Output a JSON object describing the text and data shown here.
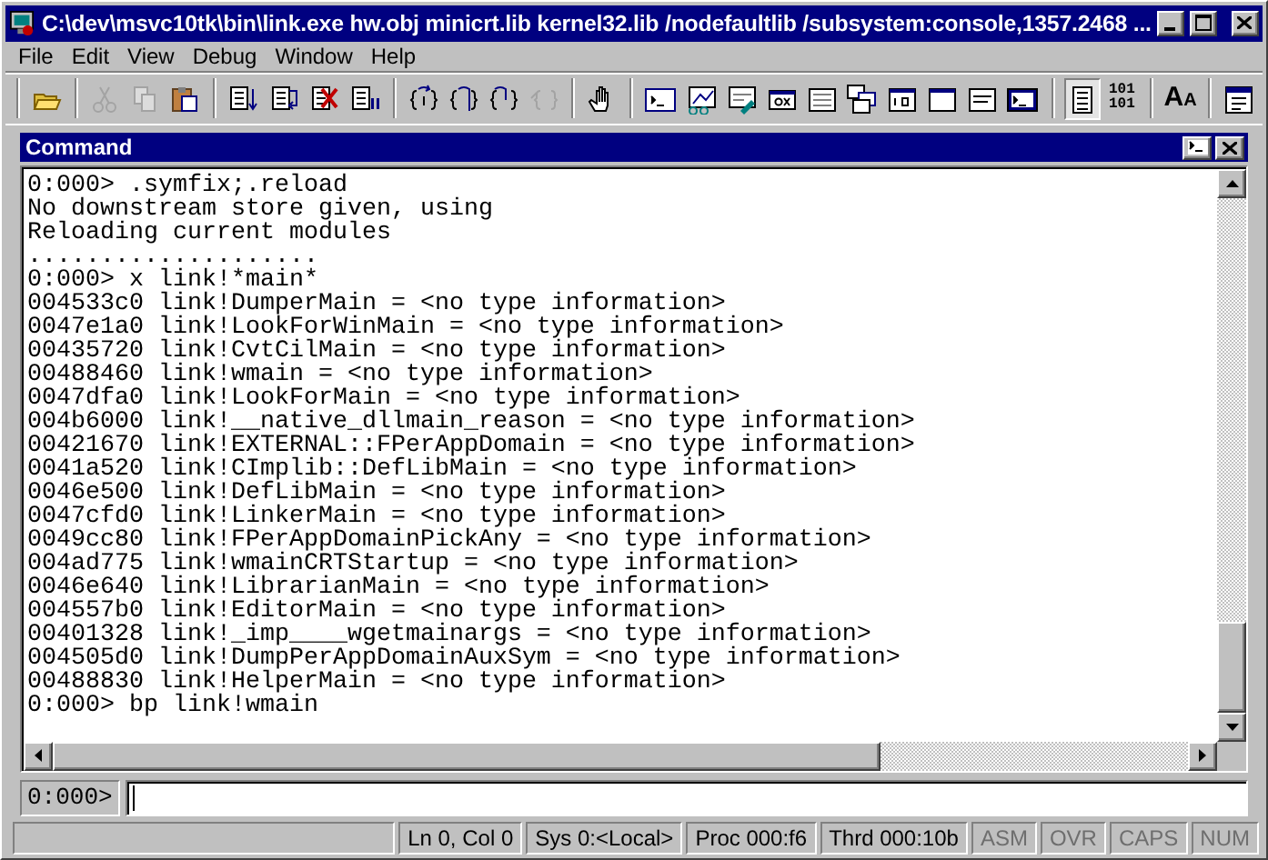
{
  "window": {
    "title": "C:\\dev\\msvc10tk\\bin\\link.exe hw.obj minicrt.lib kernel32.lib /nodefaultlib /subsystem:console,1357.2468 ..."
  },
  "menu": [
    "File",
    "Edit",
    "View",
    "Debug",
    "Window",
    "Help"
  ],
  "toolbar": [
    {
      "kind": "separator"
    },
    {
      "kind": "icon",
      "disabled": false,
      "pressed": false
    },
    {
      "kind": "separator"
    },
    {
      "kind": "icon",
      "disabled": true,
      "pressed": false
    },
    {
      "kind": "icon",
      "disabled": true,
      "pressed": false
    },
    {
      "kind": "icon",
      "disabled": false,
      "pressed": false
    },
    {
      "kind": "separator"
    },
    {
      "kind": "icon",
      "disabled": false,
      "pressed": false
    },
    {
      "kind": "icon",
      "disabled": false,
      "pressed": false
    },
    {
      "kind": "icon",
      "disabled": false,
      "pressed": false
    },
    {
      "kind": "icon",
      "disabled": false,
      "pressed": false
    },
    {
      "kind": "separator"
    },
    {
      "kind": "icon",
      "disabled": false,
      "pressed": false
    },
    {
      "kind": "icon",
      "disabled": false,
      "pressed": false
    },
    {
      "kind": "icon",
      "disabled": false,
      "pressed": false
    },
    {
      "kind": "icon",
      "disabled": true,
      "pressed": false
    },
    {
      "kind": "separator"
    },
    {
      "kind": "icon",
      "disabled": false,
      "pressed": false
    },
    {
      "kind": "separator"
    },
    {
      "kind": "icon",
      "disabled": false,
      "pressed": false
    },
    {
      "kind": "icon",
      "disabled": false,
      "pressed": false
    },
    {
      "kind": "icon",
      "disabled": false,
      "pressed": false
    },
    {
      "kind": "icon",
      "disabled": false,
      "pressed": false
    },
    {
      "kind": "icon",
      "disabled": false,
      "pressed": false
    },
    {
      "kind": "icon",
      "disabled": false,
      "pressed": false
    },
    {
      "kind": "icon",
      "disabled": false,
      "pressed": false
    },
    {
      "kind": "icon",
      "disabled": false,
      "pressed": false
    },
    {
      "kind": "icon",
      "disabled": false,
      "pressed": false
    },
    {
      "kind": "icon",
      "disabled": false,
      "pressed": false
    },
    {
      "kind": "separator"
    },
    {
      "kind": "icon",
      "disabled": false,
      "pressed": true
    },
    {
      "kind": "text",
      "lines": [
        "101",
        "101"
      ],
      "disabled": false,
      "pressed": false
    },
    {
      "kind": "separator"
    },
    {
      "kind": "text",
      "lines": [
        "A$_{A}$"
      ],
      "disabled": false,
      "pressed": false
    },
    {
      "kind": "separator"
    },
    {
      "kind": "icon",
      "disabled": false,
      "pressed": false
    }
  ],
  "command_window": {
    "title": "Command",
    "output": [
      "0:000> .symfix;.reload",
      "No downstream store given, using",
      "Reloading current modules",
      "....................",
      "0:000> x link!*main*",
      "004533c0 link!DumperMain = <no type information>",
      "0047e1a0 link!LookForWinMain = <no type information>",
      "00435720 link!CvtCilMain = <no type information>",
      "00488460 link!wmain = <no type information>",
      "0047dfa0 link!LookForMain = <no type information>",
      "004b6000 link!__native_dllmain_reason = <no type information>",
      "00421670 link!EXTERNAL::FPerAppDomain = <no type information>",
      "0041a520 link!CImplib::DefLibMain = <no type information>",
      "0046e500 link!DefLibMain = <no type information>",
      "0047cfd0 link!LinkerMain = <no type information>",
      "0049cc80 link!FPerAppDomainPickAny = <no type information>",
      "004ad775 link!wmainCRTStartup = <no type information>",
      "0046e640 link!LibrarianMain = <no type information>",
      "004557b0 link!EditorMain = <no type information>",
      "00401328 link!_imp____wgetmainargs = <no type information>",
      "004505d0 link!DumpPerAppDomainAuxSym = <no type information>",
      "00488830 link!HelperMain = <no type information>",
      "0:000> bp link!wmain"
    ],
    "prompt": "0:000>"
  },
  "status_bar": [
    {
      "text": "Ln 0, Col 0",
      "disabled": false
    },
    {
      "text": "Sys 0:<Local>",
      "disabled": false
    },
    {
      "text": "Proc 000:f6",
      "disabled": false
    },
    {
      "text": "Thrd 000:10b",
      "disabled": false
    },
    {
      "text": "ASM",
      "disabled": true
    },
    {
      "text": "OVR",
      "disabled": true
    },
    {
      "text": "CAPS",
      "disabled": true
    },
    {
      "text": "NUM",
      "disabled": true
    }
  ]
}
